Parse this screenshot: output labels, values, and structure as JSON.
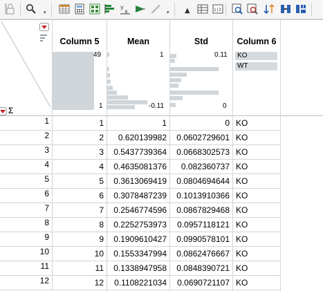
{
  "columns": {
    "col5": "Column 5",
    "mean": "Mean",
    "std": "Std",
    "col6": "Column 6"
  },
  "summary": {
    "col5_max": "49",
    "col5_min": "1",
    "mean_max": "1",
    "mean_min": "-0.11",
    "std_max": "0.11",
    "std_min": "0",
    "col6_levels": [
      "KO",
      "WT"
    ]
  },
  "rows": [
    {
      "n": "1",
      "c5": "1",
      "mean": "1",
      "std": "0",
      "c6": "KO"
    },
    {
      "n": "2",
      "c5": "2",
      "mean": "0.620139982",
      "std": "0.0602729601",
      "c6": "KO"
    },
    {
      "n": "3",
      "c5": "3",
      "mean": "0.5437739364",
      "std": "0.0668302573",
      "c6": "KO"
    },
    {
      "n": "4",
      "c5": "4",
      "mean": "0.4635081376",
      "std": "0.082360737",
      "c6": "KO"
    },
    {
      "n": "5",
      "c5": "5",
      "mean": "0.3613069419",
      "std": "0.0804694644",
      "c6": "KO"
    },
    {
      "n": "6",
      "c5": "6",
      "mean": "0.3078487239",
      "std": "0.1013910366",
      "c6": "KO"
    },
    {
      "n": "7",
      "c5": "7",
      "mean": "0.2546774596",
      "std": "0.0867829468",
      "c6": "KO"
    },
    {
      "n": "8",
      "c5": "8",
      "mean": "0.2252753973",
      "std": "0.0957118121",
      "c6": "KO"
    },
    {
      "n": "9",
      "c5": "9",
      "mean": "0.1909610427",
      "std": "0.0990578101",
      "c6": "KO"
    },
    {
      "n": "10",
      "c5": "10",
      "mean": "0.1553347994",
      "std": "0.0862476667",
      "c6": "KO"
    },
    {
      "n": "11",
      "c5": "11",
      "mean": "0.1338947958",
      "std": "0.0848390721",
      "c6": "KO"
    },
    {
      "n": "12",
      "c5": "12",
      "mean": "0.1108221034",
      "std": "0.0690721107",
      "c6": "KO"
    }
  ],
  "corner": {
    "sigma": "Σ"
  },
  "icons": [
    "lock-icon",
    "search-icon",
    "data-grid-icon",
    "calculator-icon",
    "distribution-icon",
    "bar-chart-icon",
    "fit-y-by-x-icon",
    "fit-model-icon",
    "graph-builder-icon",
    "text-size-icon",
    "table-icon",
    "script-icon",
    "zoom-icon",
    "filter-icon",
    "sort-icon",
    "join-icon",
    "split-icon"
  ],
  "colors": {
    "accent": "#cc1f1f",
    "histogram": "#cfd5d9",
    "grid": "#d4d4d4"
  }
}
